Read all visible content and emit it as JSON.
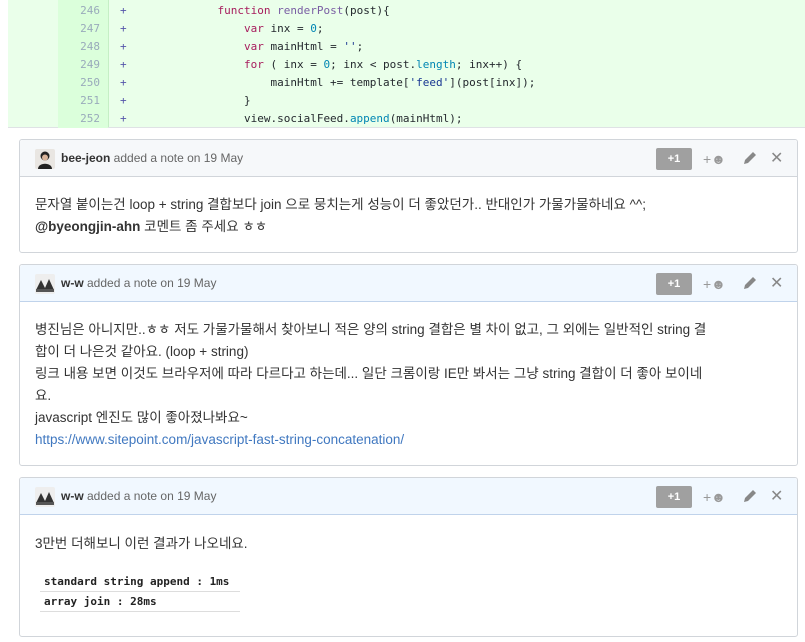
{
  "diff": {
    "lines": [
      {
        "num": "246",
        "sign": "+",
        "indent": "            ",
        "tokens": [
          [
            "kw",
            "function "
          ],
          [
            "fn",
            "renderPost"
          ],
          [
            "",
            "(post){"
          ]
        ]
      },
      {
        "num": "247",
        "sign": "+",
        "indent": "                ",
        "tokens": [
          [
            "kw",
            "var "
          ],
          [
            "",
            "inx = "
          ],
          [
            "num",
            "0"
          ],
          [
            "",
            ";"
          ]
        ]
      },
      {
        "num": "248",
        "sign": "+",
        "indent": "                ",
        "tokens": [
          [
            "kw",
            "var "
          ],
          [
            "",
            "mainHtml = "
          ],
          [
            "str",
            "''"
          ],
          [
            "",
            ";"
          ]
        ]
      },
      {
        "num": "249",
        "sign": "+",
        "indent": "                ",
        "tokens": [
          [
            "kw",
            "for"
          ],
          [
            "",
            " ( inx = "
          ],
          [
            "num",
            "0"
          ],
          [
            "",
            "; inx < post."
          ],
          [
            "prop",
            "length"
          ],
          [
            "",
            "; inx++) {"
          ]
        ]
      },
      {
        "num": "250",
        "sign": "+",
        "indent": "                    ",
        "tokens": [
          [
            "",
            "mainHtml += template["
          ],
          [
            "str",
            "'feed'"
          ],
          [
            "",
            "](post[inx]);"
          ]
        ]
      },
      {
        "num": "251",
        "sign": "+",
        "indent": "                ",
        "tokens": [
          [
            "",
            "}"
          ]
        ]
      },
      {
        "num": "252",
        "sign": "+",
        "indent": "                ",
        "tokens": [
          [
            "",
            "view.socialFeed."
          ],
          [
            "prop",
            "append"
          ],
          [
            "",
            "(mainHtml);"
          ]
        ]
      }
    ]
  },
  "notes": [
    {
      "author": "bee-jeon",
      "meta": " added a note on 19 May",
      "plus_one": "+1",
      "react": "+☻",
      "close": "✕",
      "line1": "문자열 붙이는건 loop + string 결합보다 join 으로 뭉치는게 성능이 더 좋았던가.. 반대인가 가물가물하네요 ^^;",
      "mention": "@byeongjin-ahn",
      "line2_rest": " 코멘트 좀 주세요 ㅎㅎ"
    },
    {
      "author": "w-w",
      "meta": " added a note on 19 May",
      "plus_one": "+1",
      "react": "+☻",
      "close": "✕",
      "lines": [
        "병진님은 아니지만..ㅎㅎ 저도 가물가물해서 찾아보니 적은 양의 string 결합은 별 차이 없고, 그 외에는 일반적인 string 결",
        "합이 더 나은것 같아요. (loop + string)",
        "링크 내용 보면 이것도 브라우저에 따라 다르다고 하는데... 일단 크롬이랑 IE만 봐서는 그냥 string 결합이 더 좋아 보이네",
        "요.",
        "javascript 엔진도 많이 좋아졌나봐요~"
      ],
      "link": "https://www.sitepoint.com/javascript-fast-string-concatenation/"
    },
    {
      "author": "w-w",
      "meta": " added a note on 19 May",
      "plus_one": "+1",
      "react": "+☻",
      "close": "✕",
      "line1": "3만번 더해보니 이런 결과가 나오네요.",
      "table": [
        "standard string append : 1ms",
        "array join : 28ms"
      ]
    }
  ]
}
